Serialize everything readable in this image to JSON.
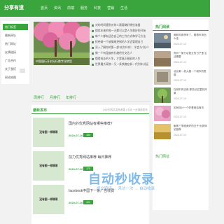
{
  "header": {
    "logo": "分享有道",
    "nav": [
      "首页",
      "资讯",
      "前端",
      "服务",
      "科技",
      "营销",
      "生活"
    ]
  },
  "sidebar": {
    "items": [
      {
        "label": "热门标签",
        "active": true
      },
      {
        "label": "最新网址"
      },
      {
        "label": "热门网址"
      },
      {
        "label": "友情链接"
      },
      {
        "label": "广告合作"
      },
      {
        "label": "关于我们"
      },
      {
        "label": "网站地图"
      }
    ]
  },
  "hero": {
    "caption": "中国银行开封分行数字化转型"
  },
  "news": [
    "对的时间遇到对的人需要做好哪些准备",
    "相信未来的每一天都可以是人生美好的开始",
    "每个人都有适合自己的工作方式和学习方法",
    "拒绝做一个被情绪控制的人学会管理自己",
    "深入了解你的第一部“成为伙伴”，学会与“别人”",
    "做一个有温度有礼貌的社交达人",
    "懂得成长的人生，才是真正精彩的人生",
    "世界最大高铁一又一条铁路在新一代列车试运"
  ],
  "tabs": [
    "周排行",
    "月排行",
    "年排行"
  ],
  "latest": {
    "title": "最新发布",
    "subtitle": "24小时内共发布资源  | 今天  一分钟前发布",
    "items": [
      {
        "title": "国内外优秀网站有哪些推荐？",
        "date": "2024-07-10",
        "badge": "189"
      },
      {
        "title": "前力优秀网站推荐 每日推荐",
        "date": "2024-07-10",
        "badge": "170"
      },
      {
        "title": "facebook中国下一条广告收费",
        "date": "2024-07-10",
        "badge": "121"
      }
    ],
    "thumb_text": "没有图一样精彩"
  },
  "hot": {
    "title": "热门阅读",
    "items": [
      {
        "text": "美股年报季来了，看看市场怎么走",
        "date": "2024-07-10"
      },
      {
        "text": "郑州一家分店营业的日子里 生活需要",
        "date": "2024-07-10"
      },
      {
        "text": "北京某一栋大楼一个城市的发展",
        "date": "2024-07-10"
      },
      {
        "text": "在城市的边缘 那些记忆里的风景",
        "date": "2024-07-10"
      },
      {
        "text": "如何设计一个好看网站首页",
        "date": "2024-07-10"
      },
      {
        "text": "聚焦三季度美好的日子 优秀网站推荐",
        "date": "2024-07-10"
      }
    ]
  },
  "fav": {
    "label": "热门网址"
  },
  "watermark": {
    "main": "自动秒收录",
    "sub": "提交链接 → 来访一次 → 自动收录"
  }
}
